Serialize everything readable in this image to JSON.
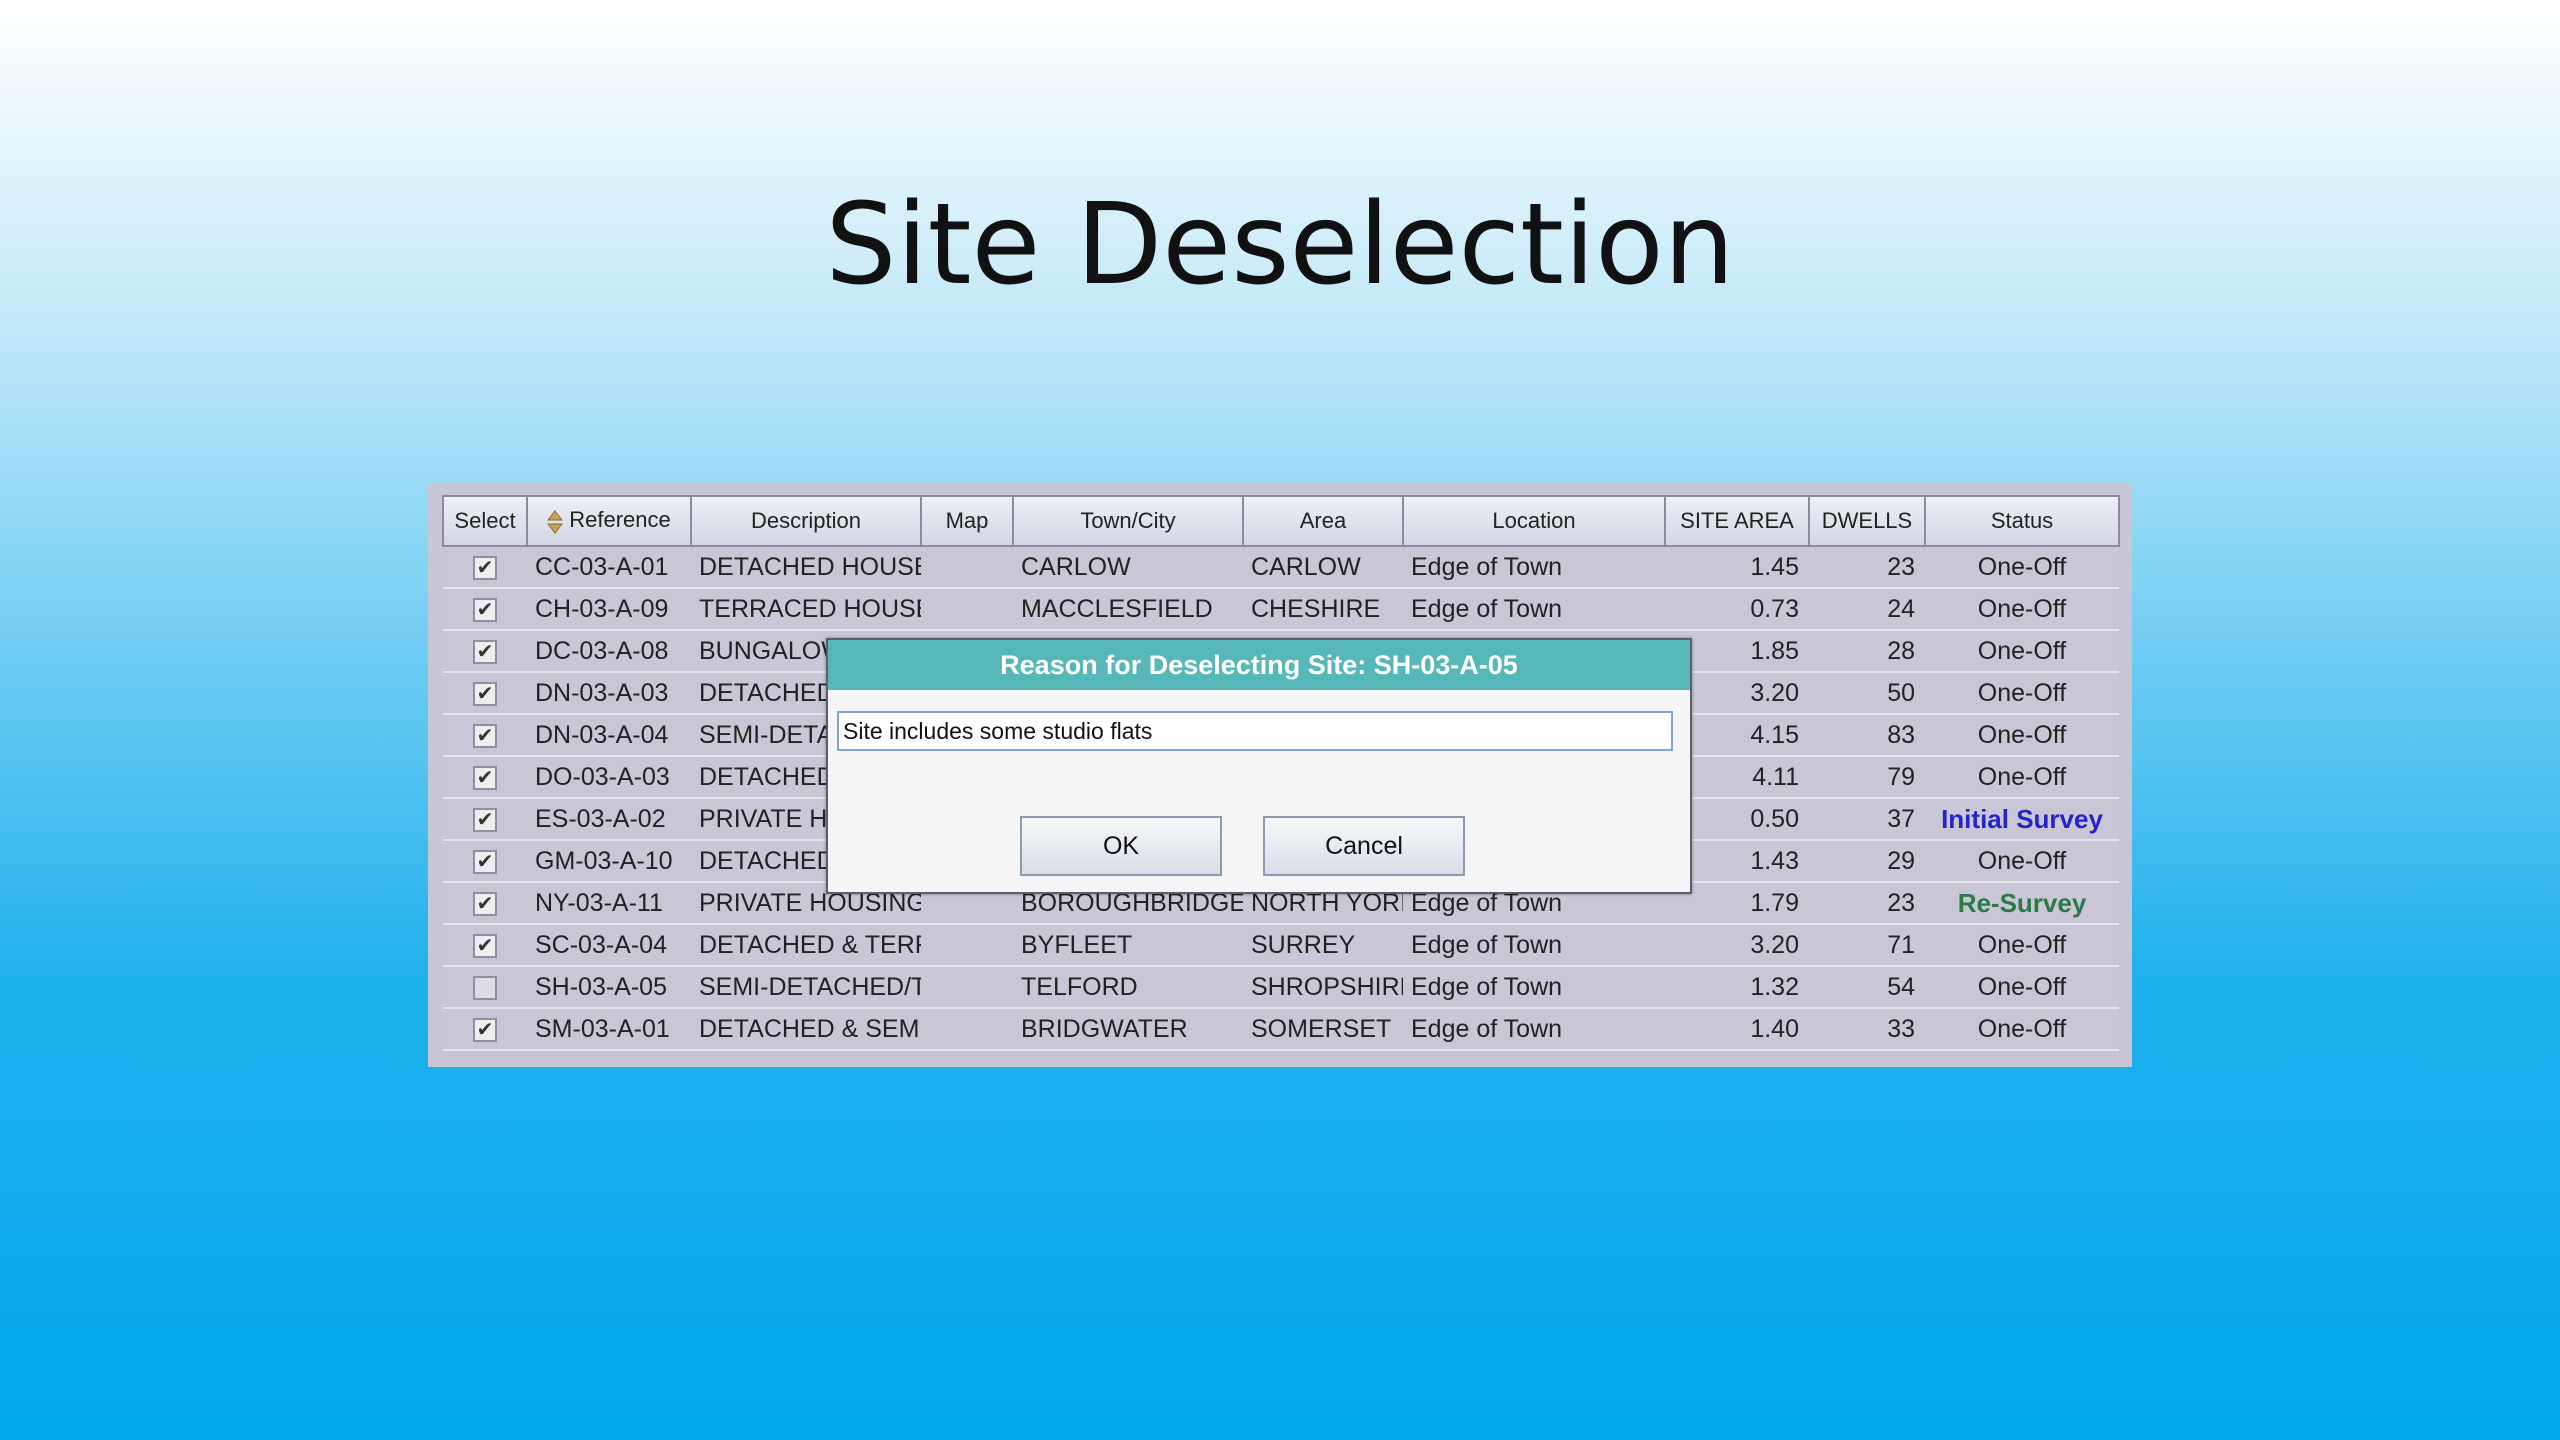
{
  "slide": {
    "title": "Site Deselection"
  },
  "grid": {
    "columns": [
      "Select",
      "Reference",
      "Description",
      "Map",
      "Town/City",
      "Area",
      "Location",
      "SITE AREA",
      "DWELLS",
      "Status"
    ],
    "rows": [
      {
        "checked": true,
        "reference": "CC-03-A-01",
        "description": "DETACHED HOUSE!",
        "map": "",
        "town": "CARLOW",
        "area": "CARLOW",
        "location": "Edge of Town",
        "site_area": "1.45",
        "dwells": "23",
        "status": "One-Off",
        "status_type": "normal"
      },
      {
        "checked": true,
        "reference": "CH-03-A-09",
        "description": "TERRACED HOUSE!",
        "map": "",
        "town": "MACCLESFIELD",
        "area": "CHESHIRE",
        "location": "Edge of Town",
        "site_area": "0.73",
        "dwells": "24",
        "status": "One-Off",
        "status_type": "normal"
      },
      {
        "checked": true,
        "reference": "DC-03-A-08",
        "description": "BUNGALOW",
        "map": "",
        "town": "",
        "area": "",
        "location": "",
        "site_area": "1.85",
        "dwells": "28",
        "status": "One-Off",
        "status_type": "normal"
      },
      {
        "checked": true,
        "reference": "DN-03-A-03",
        "description": "DETACHED/",
        "map": "",
        "town": "",
        "area": "",
        "location": "",
        "site_area": "3.20",
        "dwells": "50",
        "status": "One-Off",
        "status_type": "normal"
      },
      {
        "checked": true,
        "reference": "DN-03-A-04",
        "description": "SEMI-DETAC",
        "map": "",
        "town": "",
        "area": "",
        "location": "",
        "site_area": "4.15",
        "dwells": "83",
        "status": "One-Off",
        "status_type": "normal"
      },
      {
        "checked": true,
        "reference": "DO-03-A-03",
        "description": "DETACHED/",
        "map": "",
        "town": "",
        "area": "",
        "location": "",
        "site_area": "4.11",
        "dwells": "79",
        "status": "One-Off",
        "status_type": "normal"
      },
      {
        "checked": true,
        "reference": "ES-03-A-02",
        "description": "PRIVATE HC",
        "map": "",
        "town": "",
        "area": "",
        "location": "",
        "site_area": "0.50",
        "dwells": "37",
        "status": "Initial Survey",
        "status_type": "initial"
      },
      {
        "checked": true,
        "reference": "GM-03-A-10",
        "description": "DETACHED/",
        "map": "",
        "town": "",
        "area": "",
        "location": "",
        "site_area": "1.43",
        "dwells": "29",
        "status": "One-Off",
        "status_type": "normal"
      },
      {
        "checked": true,
        "reference": "NY-03-A-11",
        "description": "PRIVATE HOUSING",
        "map": "",
        "town": "BOROUGHBRIDGE",
        "area": "NORTH YORI",
        "location": "Edge of Town",
        "site_area": "1.79",
        "dwells": "23",
        "status": "Re-Survey",
        "status_type": "resurvey"
      },
      {
        "checked": true,
        "reference": "SC-03-A-04",
        "description": "DETACHED & TERR",
        "map": "",
        "town": "BYFLEET",
        "area": "SURREY",
        "location": "Edge of Town",
        "site_area": "3.20",
        "dwells": "71",
        "status": "One-Off",
        "status_type": "normal"
      },
      {
        "checked": false,
        "reference": "SH-03-A-05",
        "description": "SEMI-DETACHED/T",
        "map": "",
        "town": "TELFORD",
        "area": "SHROPSHIRE",
        "location": "Edge of Town",
        "site_area": "1.32",
        "dwells": "54",
        "status": "One-Off",
        "status_type": "normal"
      },
      {
        "checked": true,
        "reference": "SM-03-A-01",
        "description": "DETACHED & SEMI",
        "map": "",
        "town": "BRIDGWATER",
        "area": "SOMERSET",
        "location": "Edge of Town",
        "site_area": "1.40",
        "dwells": "33",
        "status": "One-Off",
        "status_type": "normal"
      }
    ],
    "colors": {
      "initial_survey": "#2424c8",
      "re_survey": "#2a7a4a"
    }
  },
  "dialog": {
    "title": "Reason for Deselecting Site: SH-03-A-05",
    "input_value": "Site includes some studio flats",
    "ok_label": "OK",
    "cancel_label": "Cancel",
    "title_color": "#55b7b7"
  },
  "icons": {
    "sort": "sort-arrows-icon",
    "checkbox": "checkbox-icon"
  }
}
